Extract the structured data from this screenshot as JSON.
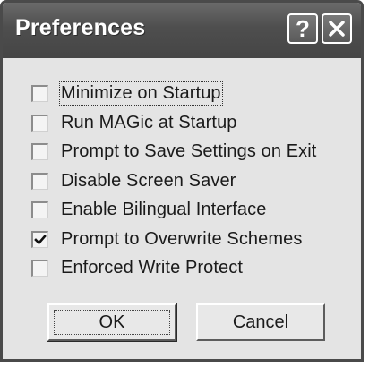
{
  "window": {
    "title": "Preferences",
    "help_label": "?",
    "close_icon": "close-icon"
  },
  "options": [
    {
      "label": "Minimize on Startup",
      "checked": false
    },
    {
      "label": "Run MAGic at Startup",
      "checked": false
    },
    {
      "label": "Prompt to Save Settings on Exit",
      "checked": false
    },
    {
      "label": "Disable Screen Saver",
      "checked": false
    },
    {
      "label": "Enable Bilingual Interface",
      "checked": false
    },
    {
      "label": "Prompt to Overwrite Schemes",
      "checked": true
    },
    {
      "label": "Enforced Write Protect",
      "checked": false
    }
  ],
  "buttons": {
    "ok_label": "OK",
    "cancel_label": "Cancel"
  }
}
